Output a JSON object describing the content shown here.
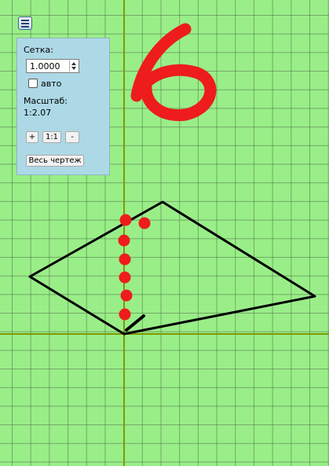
{
  "panel": {
    "grid_label": "Сетка:",
    "grid_value": "1.0000",
    "auto_label": "авто",
    "auto_checked": false,
    "scale_label": "Масштаб:",
    "scale_value": "1:2.07",
    "zoom_in_label": "+",
    "zoom_reset_label": "1:1",
    "zoom_out_label": "-",
    "fit_all_label": "Весь чертеж"
  },
  "canvas": {
    "background_color": "#99ee88",
    "axis_color": "#7f9900",
    "shape_color": "#000000",
    "annotation_color": "#ee1c1c",
    "handwritten_number": "6"
  },
  "icons": {
    "menu": "hamburger-menu-icon"
  }
}
